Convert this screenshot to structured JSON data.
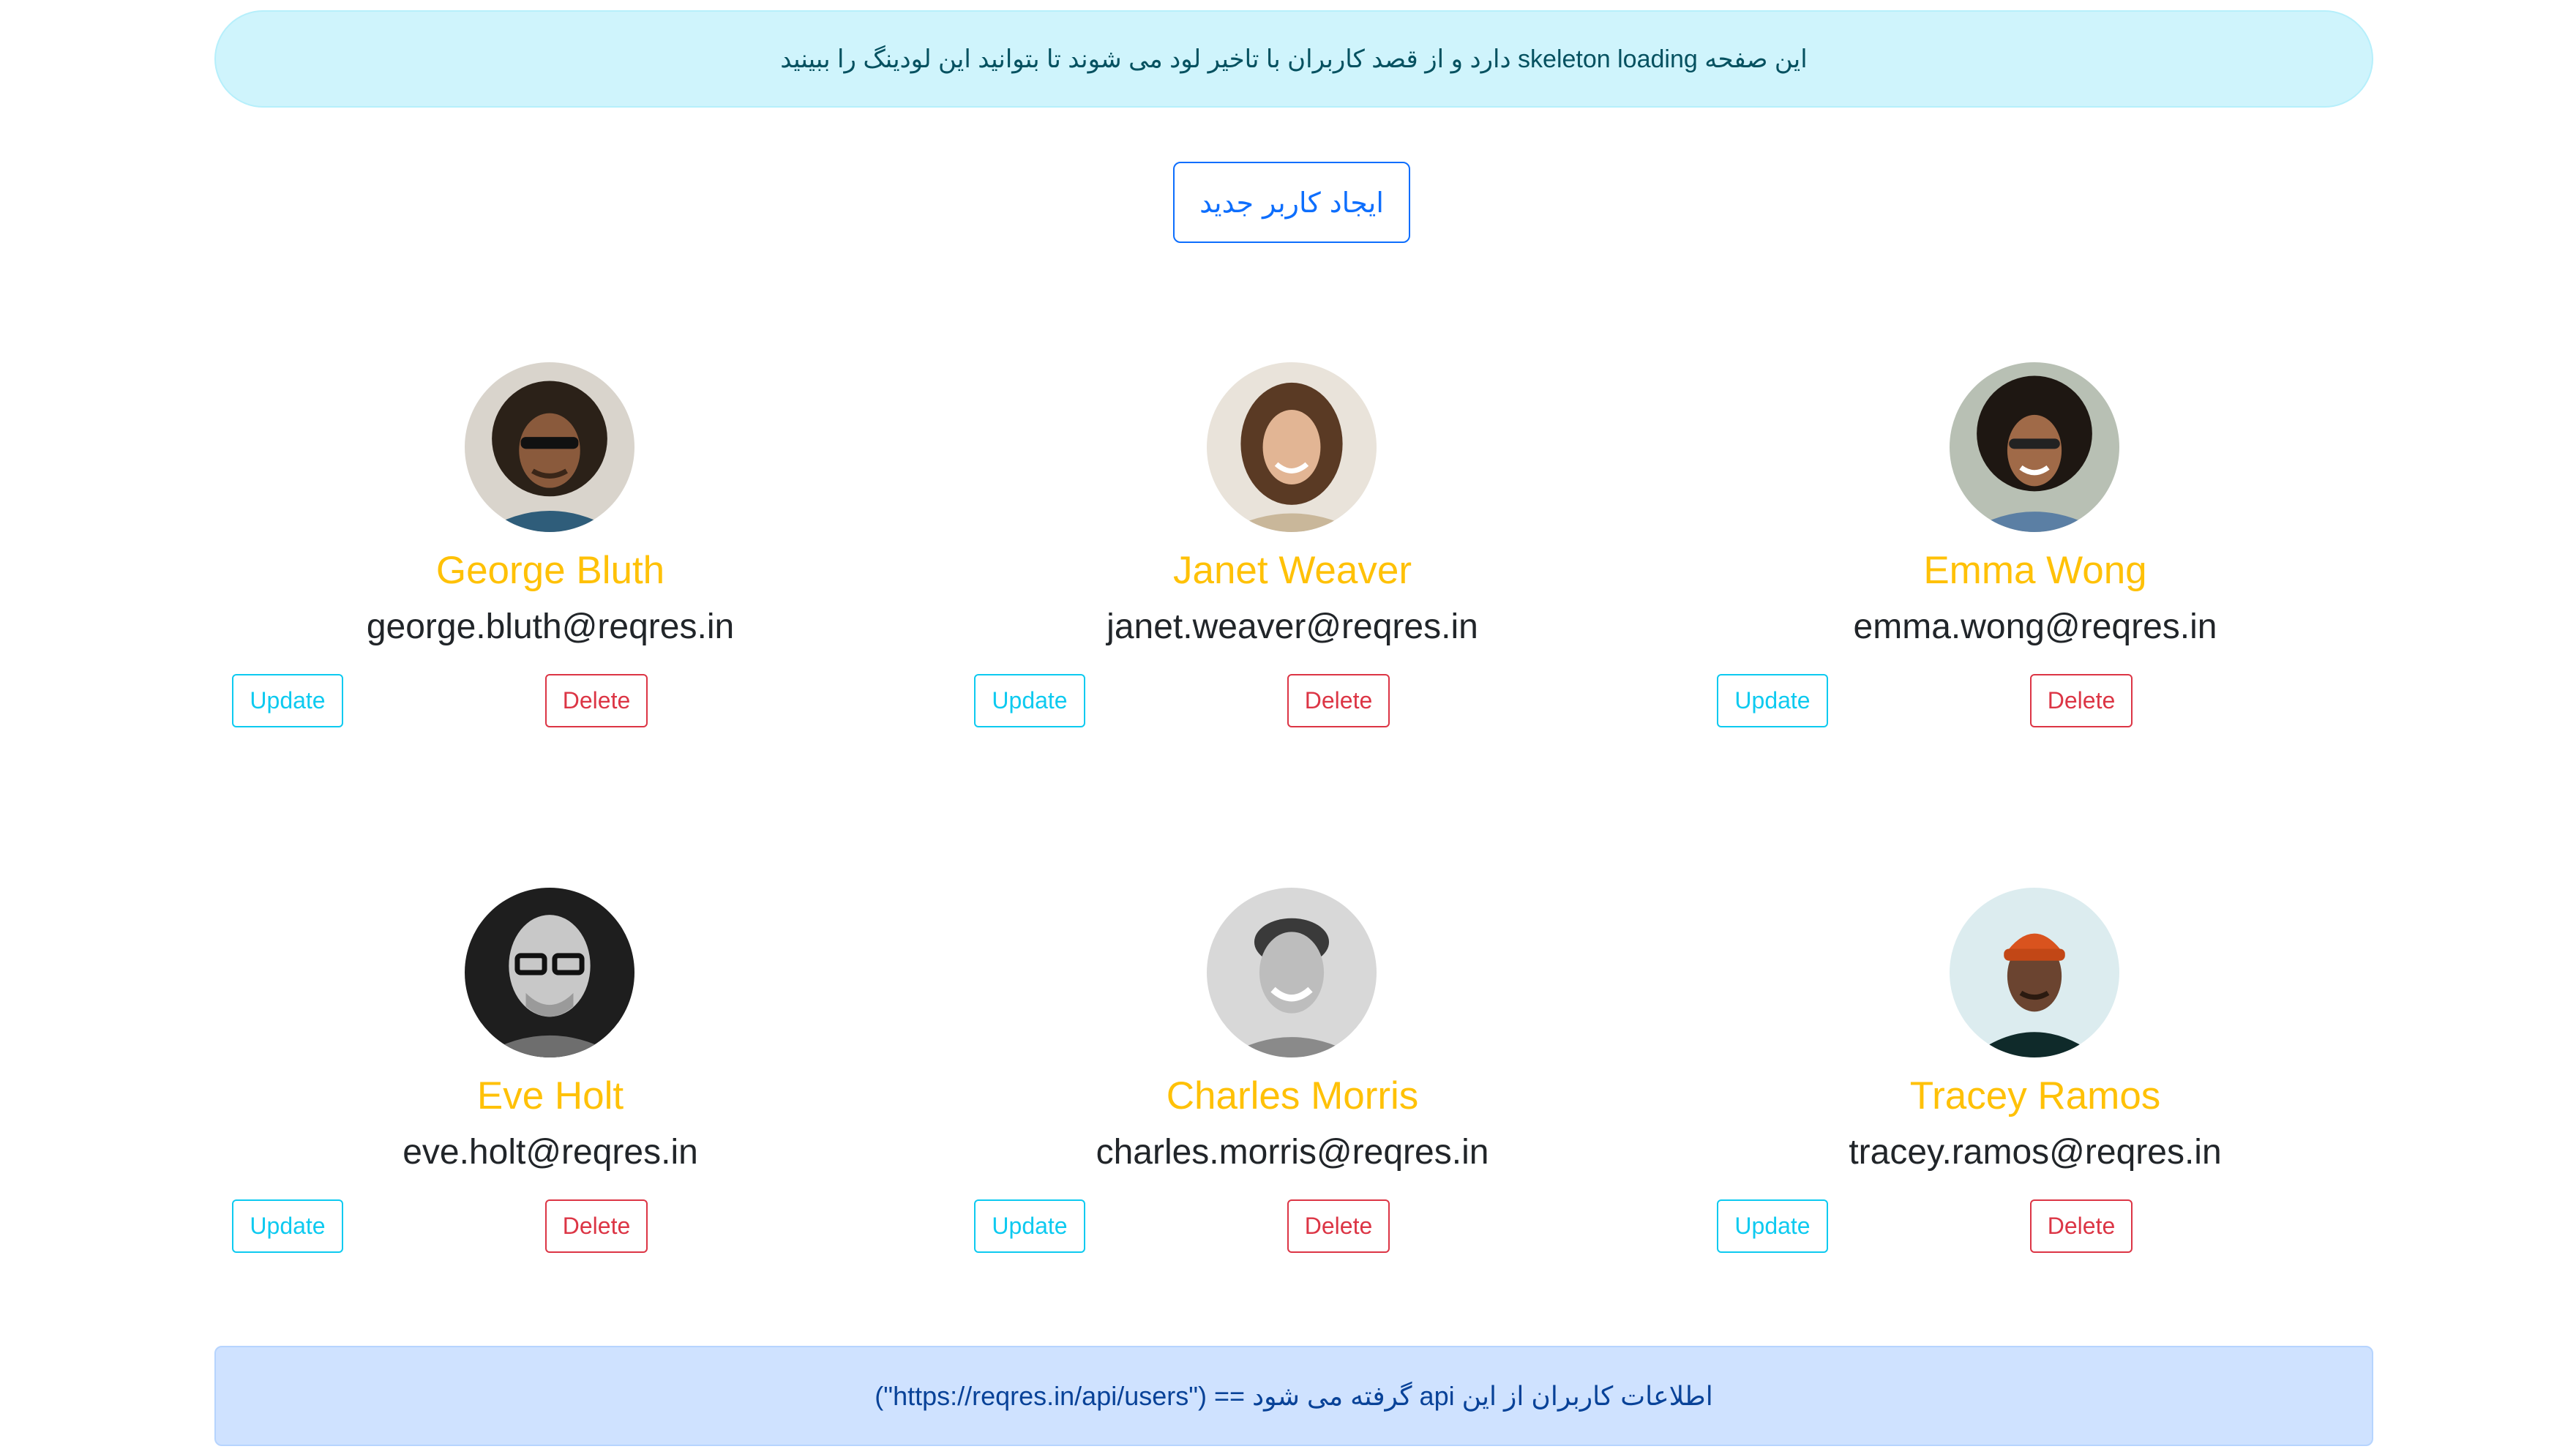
{
  "top_alert": {
    "text": "این صفحه skeleton loading دارد و از قصد کاربران با تاخیر لود می شوند تا بتوانید این لودینگ را ببینید"
  },
  "create_button": {
    "label": "ایجاد کاربر جدید"
  },
  "users": [
    {
      "name": "George Bluth",
      "email": "george.bluth@reqres.in",
      "update_label": "Update",
      "delete_label": "Delete"
    },
    {
      "name": "Janet Weaver",
      "email": "janet.weaver@reqres.in",
      "update_label": "Update",
      "delete_label": "Delete"
    },
    {
      "name": "Emma Wong",
      "email": "emma.wong@reqres.in",
      "update_label": "Update",
      "delete_label": "Delete"
    },
    {
      "name": "Eve Holt",
      "email": "eve.holt@reqres.in",
      "update_label": "Update",
      "delete_label": "Delete"
    },
    {
      "name": "Charles Morris",
      "email": "charles.morris@reqres.in",
      "update_label": "Update",
      "delete_label": "Delete"
    },
    {
      "name": "Tracey Ramos",
      "email": "tracey.ramos@reqres.in",
      "update_label": "Update",
      "delete_label": "Delete"
    }
  ],
  "bottom_alert": {
    "text": "اطلاعات کاربران از این api گرفته می شود == (\"https://reqres.in/api/users\")"
  },
  "colors": {
    "name": "#ffc107",
    "update": "#0dcaf0",
    "delete": "#dc3545",
    "primary": "#0d6efd",
    "info_bg": "#cff4fc",
    "primary_bg": "#cfe2ff"
  }
}
